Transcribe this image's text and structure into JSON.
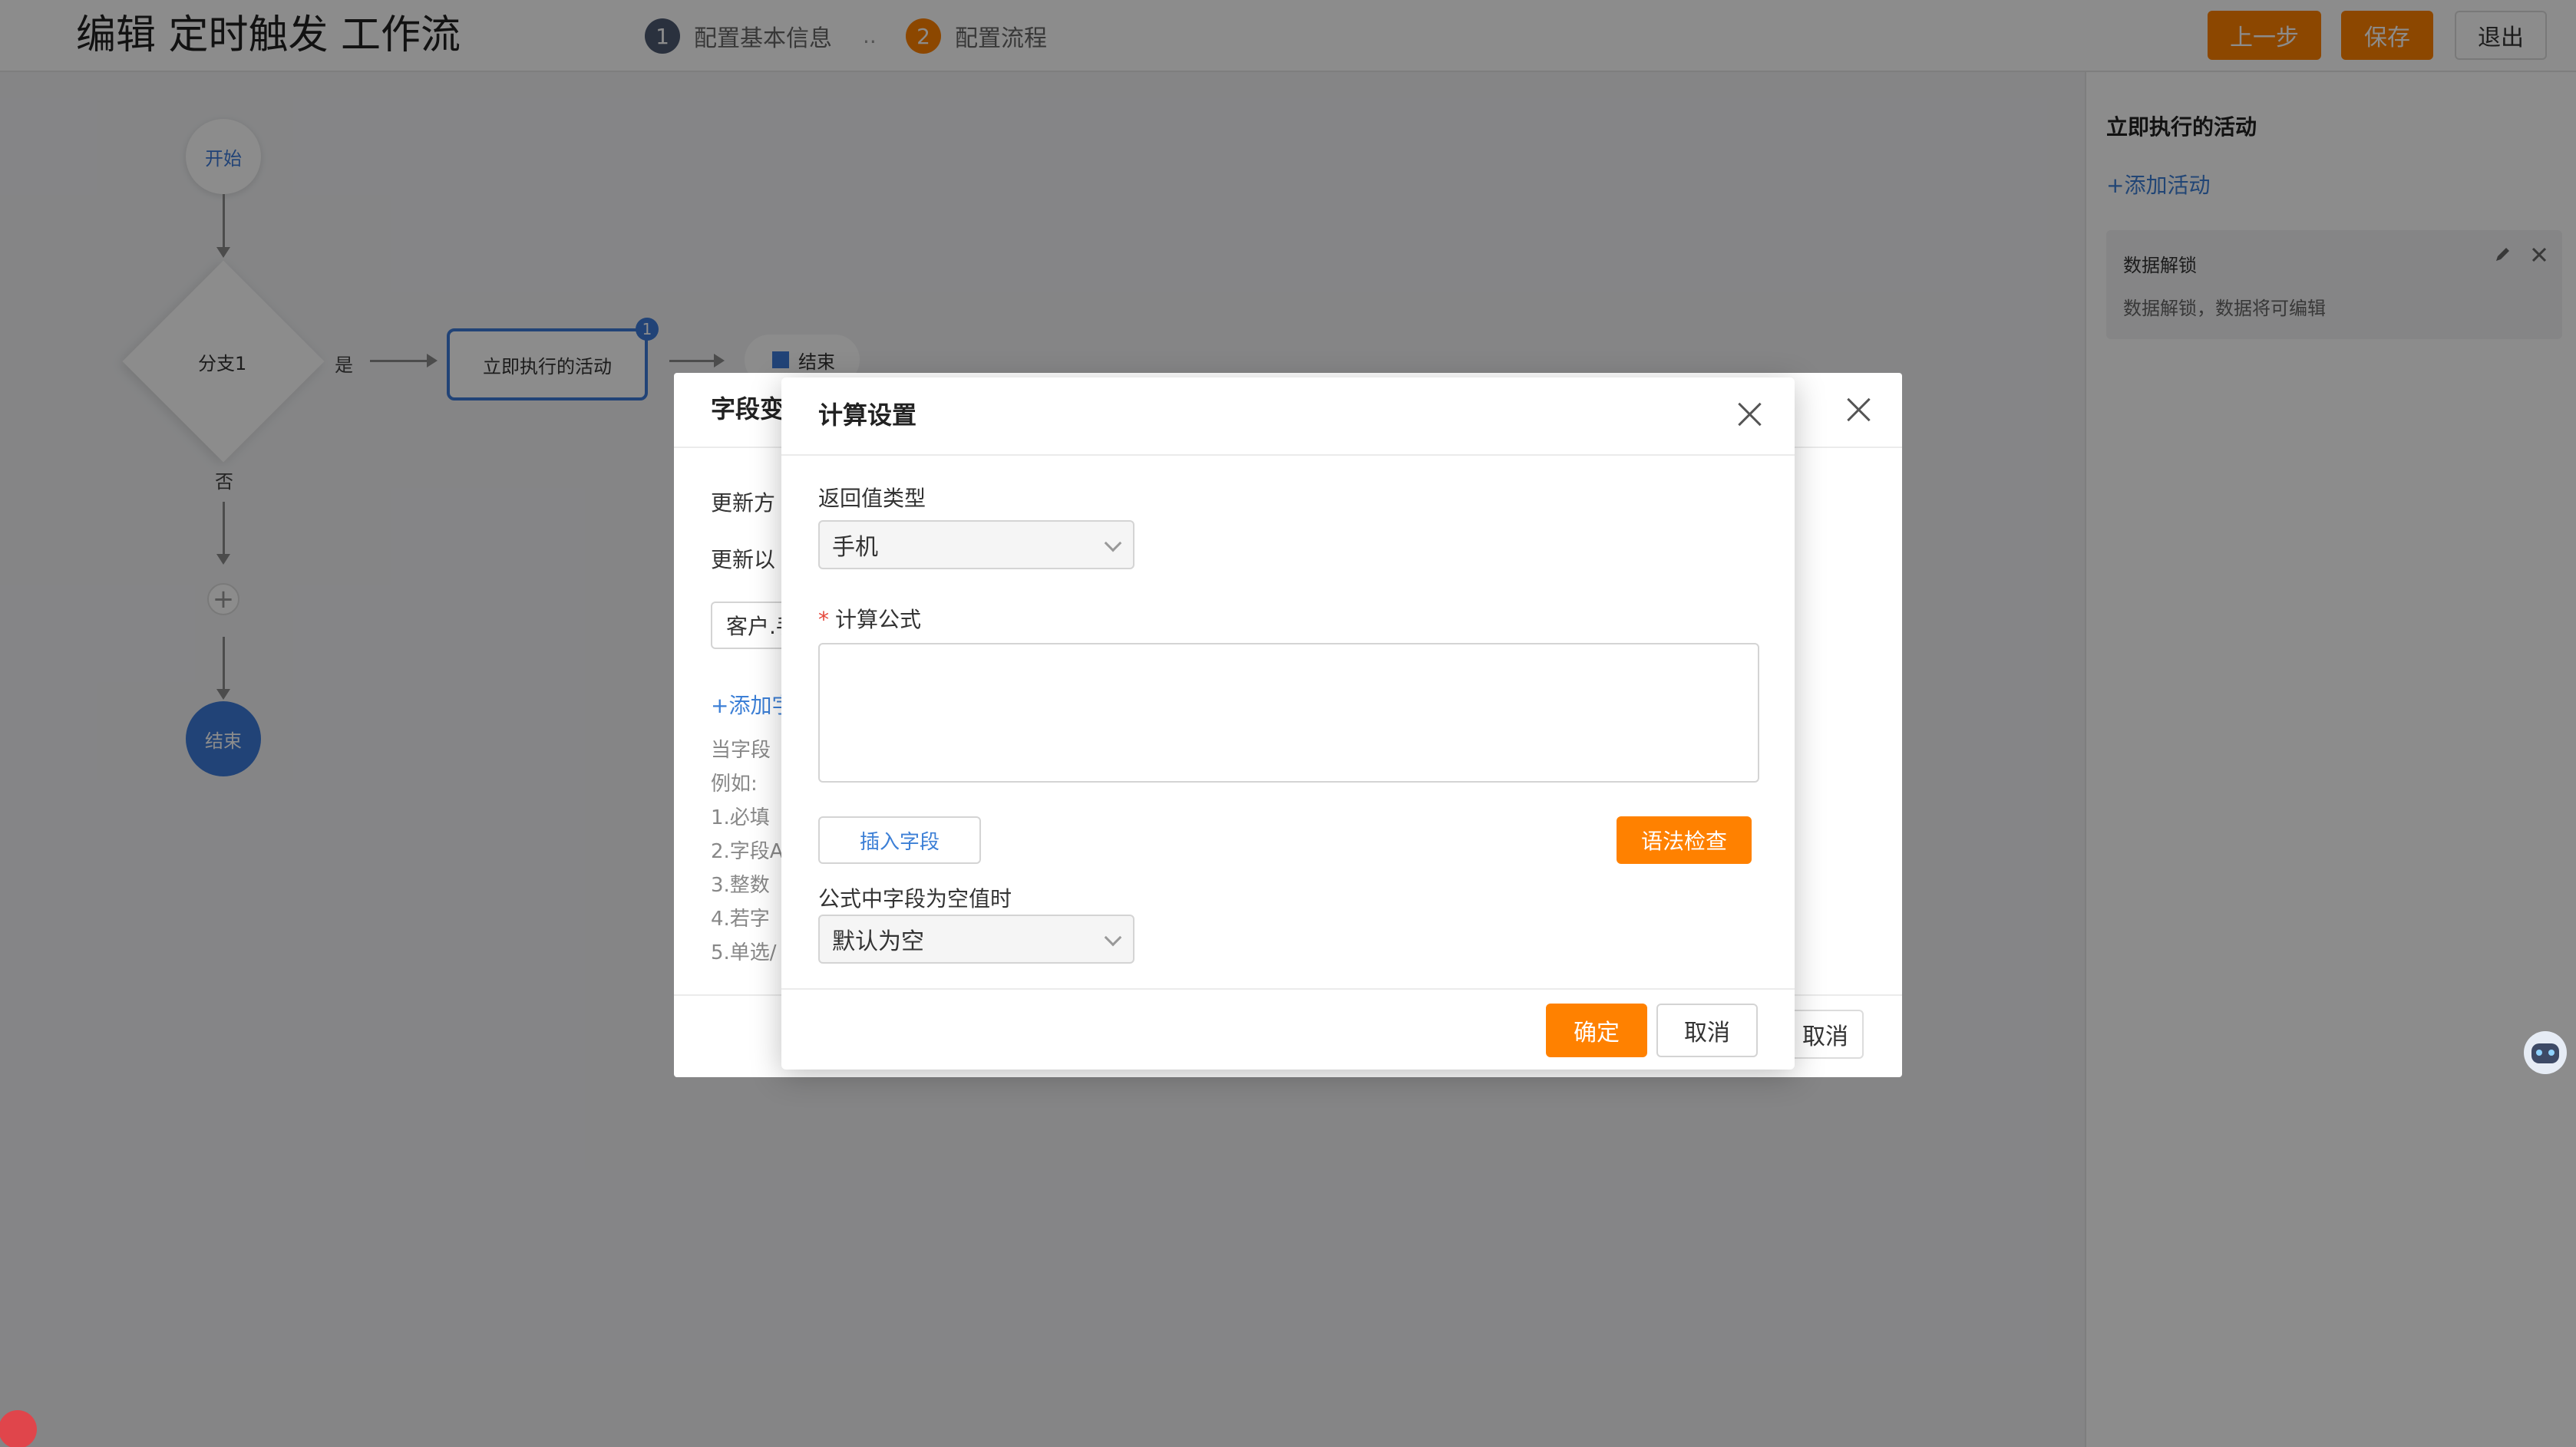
{
  "header": {
    "title": "编辑 定时触发 工作流",
    "steps": [
      {
        "num": "1",
        "label": "配置基本信息"
      },
      {
        "num": "2",
        "label": "配置流程"
      }
    ],
    "step_separator": "..",
    "buttons": {
      "prev": "上一步",
      "save": "保存",
      "exit": "退出"
    }
  },
  "flow": {
    "start": "开始",
    "branch": "分支1",
    "yes": "是",
    "no": "否",
    "activity": "立即执行的活动",
    "activity_badge": "1",
    "end_small": "结束",
    "add": "+",
    "end": "结束"
  },
  "right_panel": {
    "title": "立即执行的活动",
    "add_link": "+添加活动",
    "card": {
      "title": "数据解锁",
      "desc": "数据解锁，数据将可编辑"
    }
  },
  "bg_dialog": {
    "title_partial": "字段变",
    "row1": "更新方",
    "row2": "更新以",
    "field_value": "客户.手",
    "add_link": "+添加字",
    "help_lines": [
      "当字段",
      "例如:",
      "1.必填",
      "2.字段A",
      "3.整数",
      "4.若字",
      "5.单选/"
    ],
    "cancel": "取消"
  },
  "modal": {
    "title": "计算设置",
    "return_type_label": "返回值类型",
    "return_type_value": "手机",
    "formula_label": "计算公式",
    "required_mark": "*",
    "insert_field": "插入字段",
    "syntax_check": "语法检查",
    "empty_label": "公式中字段为空值时",
    "empty_value": "默认为空",
    "confirm": "确定",
    "cancel": "取消"
  },
  "colors": {
    "accent": "#ff8100",
    "link": "#3c7fd6",
    "node_blue": "#3d7bd9"
  }
}
